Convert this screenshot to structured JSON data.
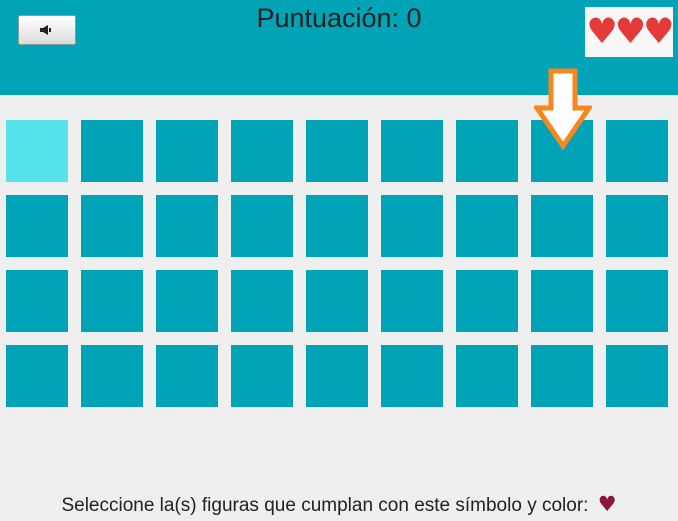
{
  "header": {
    "sound_button": {
      "icon": "speaker-icon"
    },
    "score_label": "Puntuación: 0",
    "lives": {
      "symbol": "♥♥♥",
      "count": 3,
      "color": "#e53a3a"
    }
  },
  "grid": {
    "rows": 4,
    "columns": 9,
    "tile_color": "#00a4b6",
    "selected_tile_color": "#56e3ec",
    "selected_tiles": [
      [
        0,
        0
      ]
    ]
  },
  "pointer": {
    "icon": "down-arrow-icon",
    "color": "#f7861e",
    "column": 7
  },
  "instruction": {
    "text": "Seleccione la(s) figuras que cumplan con este símbolo y color:",
    "target_symbol": "♥",
    "target_color": "#8a1545"
  }
}
